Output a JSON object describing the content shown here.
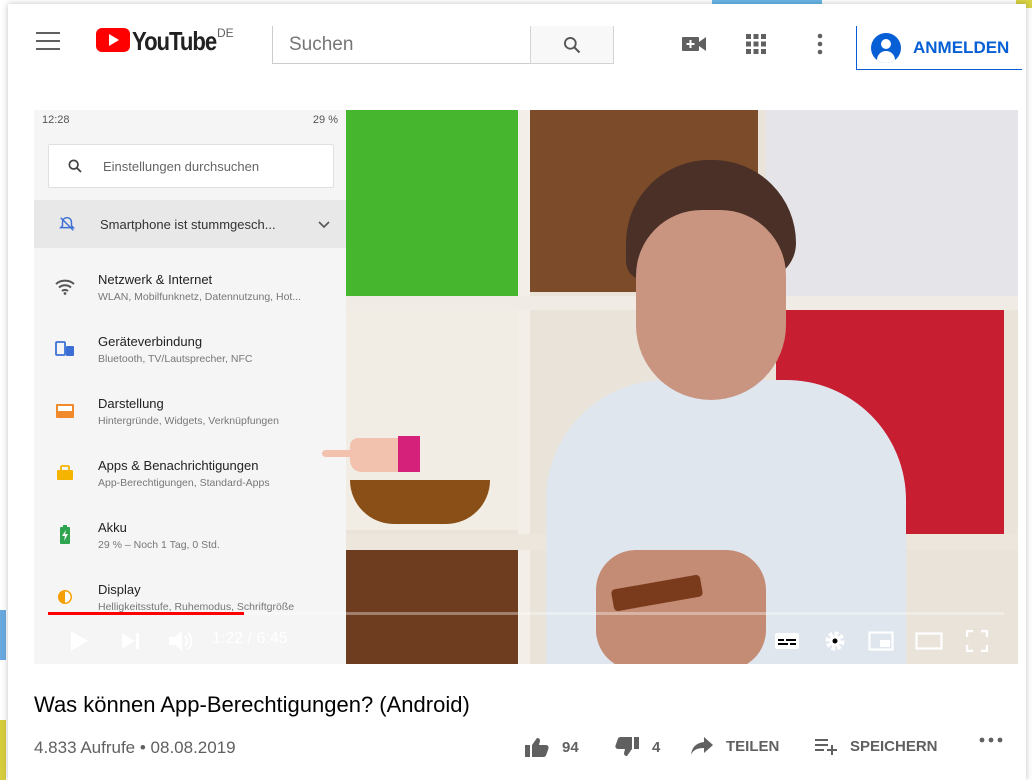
{
  "header": {
    "logo_text": "YouTube",
    "logo_region": "DE",
    "search_placeholder": "Suchen",
    "signin_label": "ANMELDEN"
  },
  "icons": {
    "menu": "hamburger-icon",
    "search": "search-icon",
    "create": "video-camera-icon",
    "apps": "apps-grid-icon",
    "more": "more-vertical-icon",
    "account": "account-circle-icon"
  },
  "video_overlay": {
    "status_time": "12:28",
    "status_battery": "29 %",
    "search_placeholder": "Einstellungen durchsuchen",
    "highlight_row": "Smartphone ist stummgesch...",
    "items": [
      {
        "title": "Netzwerk & Internet",
        "subtitle": "WLAN, Mobilfunknetz, Datennutzung, Hot..."
      },
      {
        "title": "Geräteverbindung",
        "subtitle": "Bluetooth, TV/Lautsprecher, NFC"
      },
      {
        "title": "Darstellung",
        "subtitle": "Hintergründe, Widgets, Verknüpfungen"
      },
      {
        "title": "Apps & Benachrichtigungen",
        "subtitle": "App-Berechtigungen, Standard-Apps"
      },
      {
        "title": "Akku",
        "subtitle": "29 % – Noch 1 Tag, 0 Std."
      },
      {
        "title": "Display",
        "subtitle": "Helligkeitsstufe, Ruhemodus, Schriftgröße"
      }
    ]
  },
  "player": {
    "time_display": "1:22 / 6:45",
    "progress": 0.205
  },
  "video": {
    "title": "Was können App-Berechtigungen? (Android)",
    "views_date": "4.833 Aufrufe • 08.08.2019",
    "likes": "94",
    "dislikes": "4",
    "share_label": "TEILEN",
    "save_label": "SPEICHERN"
  },
  "colors": {
    "brand_red": "#ff0000",
    "link_blue": "#065fd4"
  }
}
